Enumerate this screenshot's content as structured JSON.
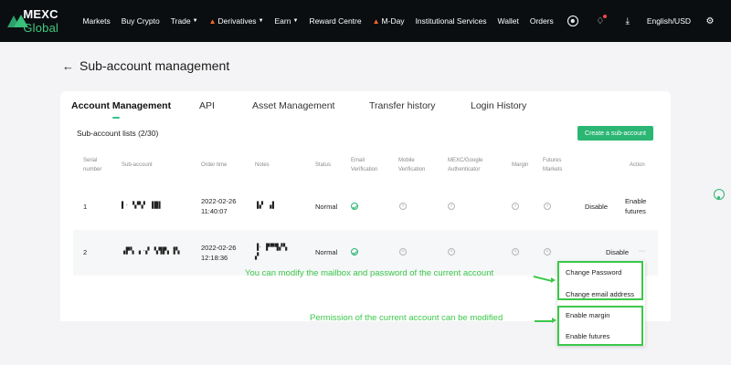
{
  "nav": {
    "logo_main": "MEXC",
    "logo_accent": "Global",
    "items": [
      "Markets",
      "Buy Crypto",
      "Trade",
      "Derivatives",
      "Earn",
      "Reward Centre",
      "M-Day",
      "Institutional Services"
    ],
    "right": [
      "Wallet",
      "Orders"
    ],
    "language": "English/USD"
  },
  "page": {
    "title": "Sub-account management",
    "tabs": [
      "Account Management",
      "API",
      "Asset Management",
      "Transfer history",
      "Login History"
    ],
    "active_tab": "Account Management",
    "list_title": "Sub-account lists (2/30)",
    "create_button": "Create a sub-account"
  },
  "table": {
    "headers": {
      "serial": [
        "Serial",
        "number"
      ],
      "sub_account": "Sub-account",
      "order_time": "Order time",
      "notes": "Notes",
      "status": "Status",
      "email": [
        "Email",
        "Verification"
      ],
      "mobile": [
        "Mobile",
        "Verification"
      ],
      "google": [
        "MEXC/Google",
        "Authenticator"
      ],
      "margin": "Margin",
      "futures": [
        "Futures",
        "Markets"
      ],
      "action": "Action"
    },
    "rows": [
      {
        "serial": "1",
        "sub_account": "▌‧ ▚▀▞ ▐█▌",
        "order_date": "2022-02-26",
        "order_clock": "11:40:07",
        "notes": "▐▞ ▗▌",
        "status": "Normal",
        "action_disable": "Disable",
        "action_enable": [
          "Enable",
          "futures"
        ]
      },
      {
        "serial": "2",
        "sub_account": "▗▛▚ ▖‧▞ ▚▜▛▖▐▚",
        "order_date": "2022-02-26",
        "order_clock": "12:18:36",
        "notes": [
          "▐‧ ▛▀▜▞▚",
          "▞"
        ],
        "status": "Normal",
        "action_disable": "Disable",
        "action_more": "···"
      }
    ]
  },
  "dropdown": {
    "items": [
      "Change Password",
      "Change email address",
      "Enable margin",
      "Enable futures"
    ]
  },
  "annotations": {
    "first": "You can modify the mailbox and password of the current account",
    "second": "Permission of the current account can be modified"
  },
  "colors": {
    "accent_green": "#2bb673",
    "annotation_green": "#3cc84a",
    "nav_bg": "#0b0e11"
  }
}
